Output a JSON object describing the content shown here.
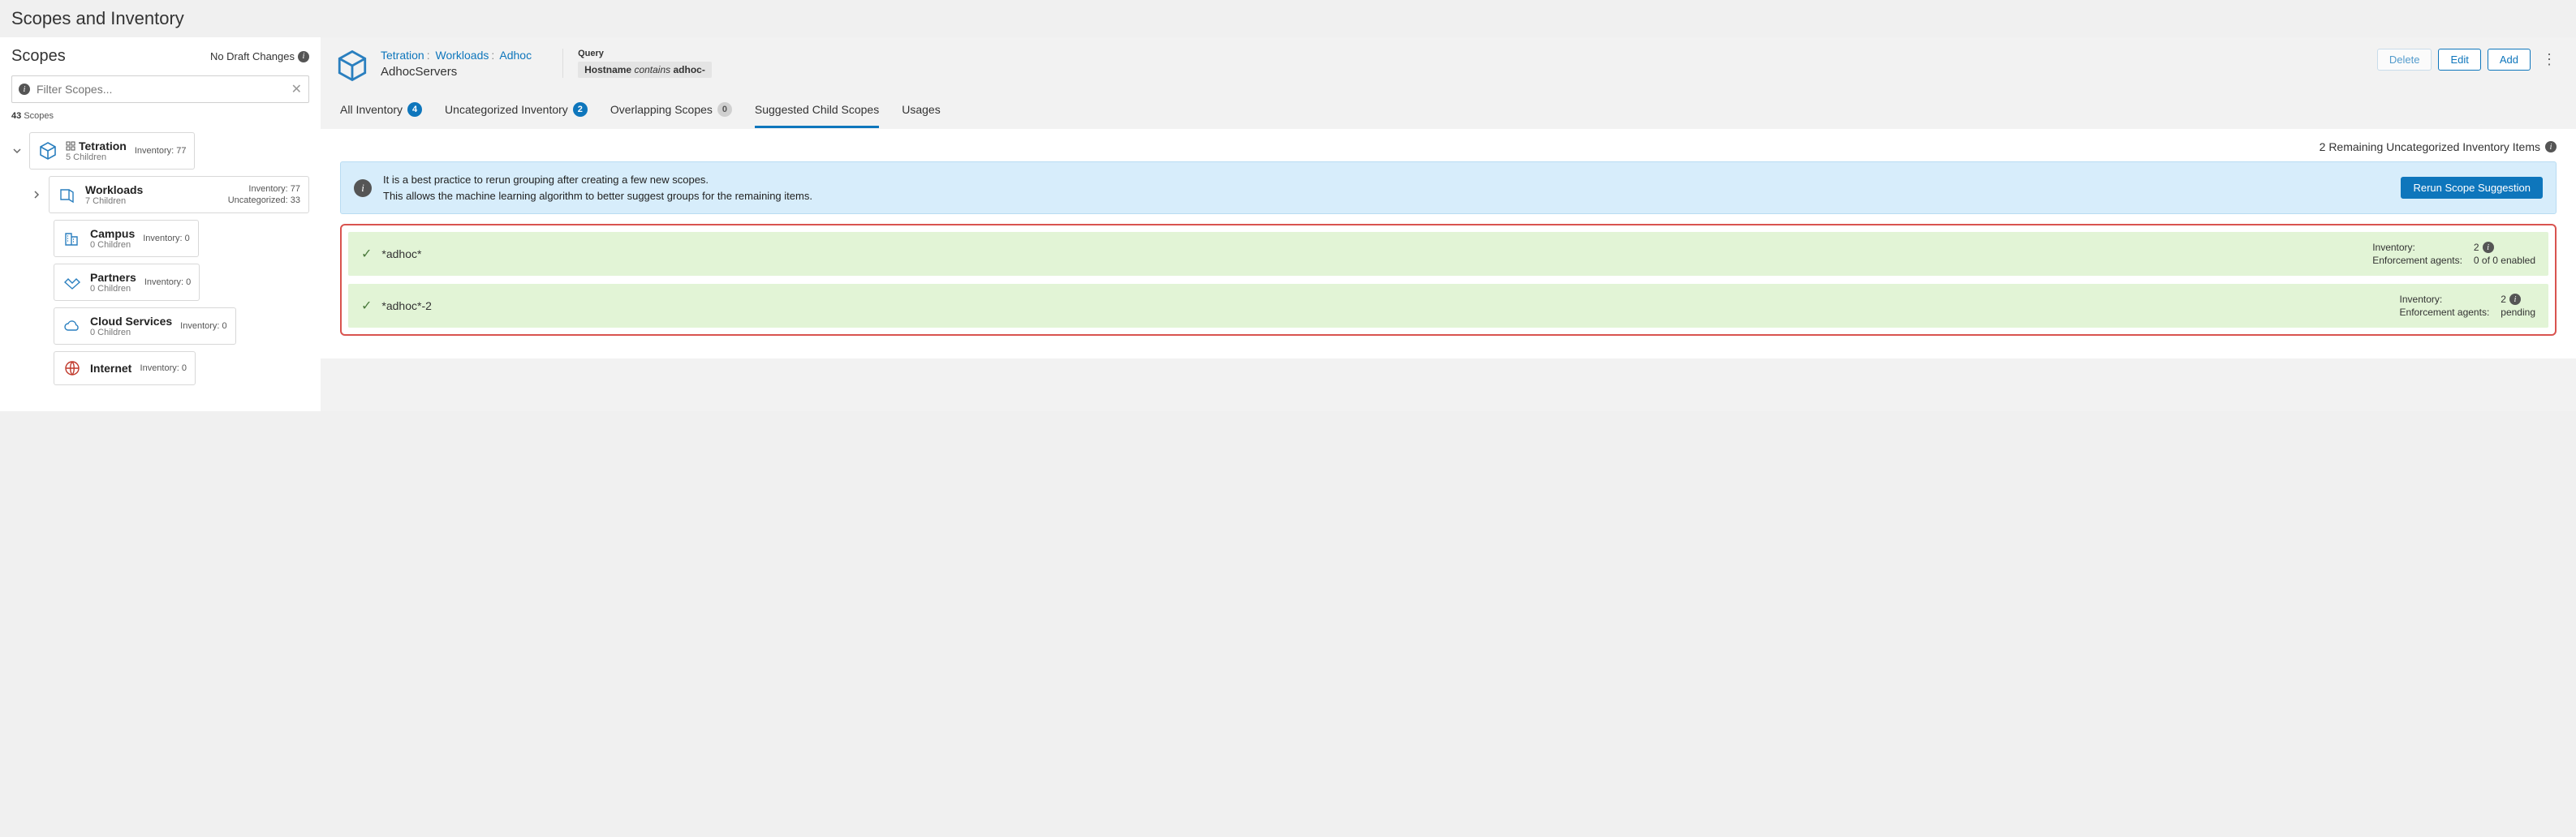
{
  "page_title": "Scopes and Inventory",
  "sidebar": {
    "title": "Scopes",
    "draft_changes": "No Draft Changes",
    "filter_placeholder": "Filter Scopes...",
    "total_label": "Scopes",
    "total_count": "43"
  },
  "tree": {
    "root": {
      "name": "Tetration",
      "children_label": "5 Children",
      "inventory_label": "Inventory: 77"
    },
    "workloads": {
      "name": "Workloads",
      "children_label": "7 Children",
      "inventory_label": "Inventory: 77",
      "uncat_label": "Uncategorized: 33"
    },
    "campus": {
      "name": "Campus",
      "children_label": "0 Children",
      "inventory_label": "Inventory: 0"
    },
    "partners": {
      "name": "Partners",
      "children_label": "0 Children",
      "inventory_label": "Inventory: 0"
    },
    "cloud": {
      "name": "Cloud Services",
      "children_label": "0 Children",
      "inventory_label": "Inventory: 0"
    },
    "internet": {
      "name": "Internet",
      "inventory_label": "Inventory: 0"
    }
  },
  "breadcrumb": {
    "a": "Tetration",
    "b": "Workloads",
    "c": "Adhoc",
    "scope_name": "AdhocServers"
  },
  "query": {
    "label": "Query",
    "field": "Hostname",
    "op": "contains",
    "value": "adhoc-"
  },
  "actions": {
    "delete": "Delete",
    "edit": "Edit",
    "add": "Add"
  },
  "tabs": {
    "all": "All Inventory",
    "all_count": "4",
    "uncat": "Uncategorized Inventory",
    "uncat_count": "2",
    "overlap": "Overlapping Scopes",
    "overlap_count": "0",
    "suggested": "Suggested Child Scopes",
    "usages": "Usages"
  },
  "remaining": "2 Remaining Uncategorized Inventory Items",
  "banner": {
    "line1": "It is a best practice to rerun grouping after creating a few new scopes.",
    "line2": "This allows the machine learning algorithm to better suggest groups for the remaining items.",
    "button": "Rerun Scope Suggestion"
  },
  "suggestions": [
    {
      "name": "*adhoc*",
      "inv_label": "Inventory:",
      "inv_val": "2",
      "enf_label": "Enforcement agents:",
      "enf_val": "0 of 0 enabled"
    },
    {
      "name": "*adhoc*-2",
      "inv_label": "Inventory:",
      "inv_val": "2",
      "enf_label": "Enforcement agents:",
      "enf_val": "pending"
    }
  ]
}
